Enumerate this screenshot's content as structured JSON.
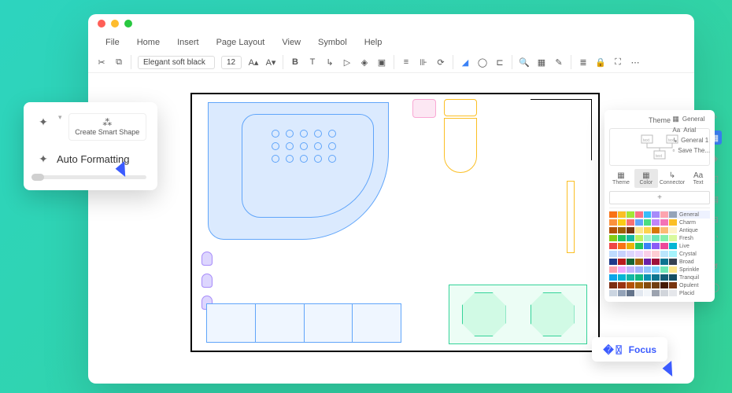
{
  "window": {
    "dots": [
      "#ff5f57",
      "#febc2e",
      "#28c840"
    ]
  },
  "menu": [
    "File",
    "Home",
    "Insert",
    "Page Layout",
    "View",
    "Symbol",
    "Help"
  ],
  "toolbar": {
    "font": "Elegant soft black",
    "size": "12"
  },
  "popup": {
    "create_shape": "Create Smart Shape",
    "auto_fmt": "Auto Formatting"
  },
  "theme": {
    "title": "Theme",
    "tabs": [
      "Theme",
      "Color",
      "Connector",
      "Text"
    ],
    "side": [
      "General",
      "Arial",
      "General 1",
      "Save The..."
    ],
    "schemes": [
      "General",
      "Charm",
      "Antique",
      "Fresh",
      "Live",
      "Crystal",
      "Broad",
      "Sprinkle",
      "Tranquil",
      "Opulent",
      "Placid"
    ],
    "palettes": [
      [
        "#f97316",
        "#fbbf24",
        "#a3e635",
        "#fb7185",
        "#38bdf8",
        "#a78bfa",
        "#fda4af",
        "#94a3b8"
      ],
      [
        "#fb923c",
        "#facc15",
        "#f87171",
        "#60a5fa",
        "#4ade80",
        "#c084fc",
        "#f472b6",
        "#fbbf24"
      ],
      [
        "#b45309",
        "#a16207",
        "#78350f",
        "#fde68a",
        "#fcd34d",
        "#d97706",
        "#fdba74",
        "#fef3c7"
      ],
      [
        "#84cc16",
        "#22c55e",
        "#14b8a6",
        "#bef264",
        "#a7f3d0",
        "#6ee7b7",
        "#86efac",
        "#d9f99d"
      ],
      [
        "#ef4444",
        "#f97316",
        "#eab308",
        "#22c55e",
        "#3b82f6",
        "#8b5cf6",
        "#ec4899",
        "#06b6d4"
      ],
      [
        "#bfdbfe",
        "#c7d2fe",
        "#ddd6fe",
        "#e9d5ff",
        "#fbcfe8",
        "#fecdd3",
        "#bae6fd",
        "#a5f3fc"
      ],
      [
        "#1e3a8a",
        "#b91c1c",
        "#166534",
        "#a16207",
        "#6b21a8",
        "#9f1239",
        "#0e7490",
        "#374151"
      ],
      [
        "#fda4af",
        "#f0abfc",
        "#c4b5fd",
        "#a5b4fc",
        "#93c5fd",
        "#7dd3fc",
        "#6ee7b7",
        "#fde68a"
      ],
      [
        "#0ea5e9",
        "#06b6d4",
        "#14b8a6",
        "#10b981",
        "#0891b2",
        "#0e7490",
        "#155e75",
        "#164e63"
      ],
      [
        "#7c2d12",
        "#9a3412",
        "#b45309",
        "#a16207",
        "#854d0e",
        "#713f12",
        "#451a03",
        "#78350f"
      ],
      [
        "#cbd5e1",
        "#94a3b8",
        "#64748b",
        "#e2e8f0",
        "#f1f5f9",
        "#9ca3af",
        "#d1d5db",
        "#e5e7eb"
      ]
    ]
  },
  "focus": {
    "label": "Focus"
  }
}
